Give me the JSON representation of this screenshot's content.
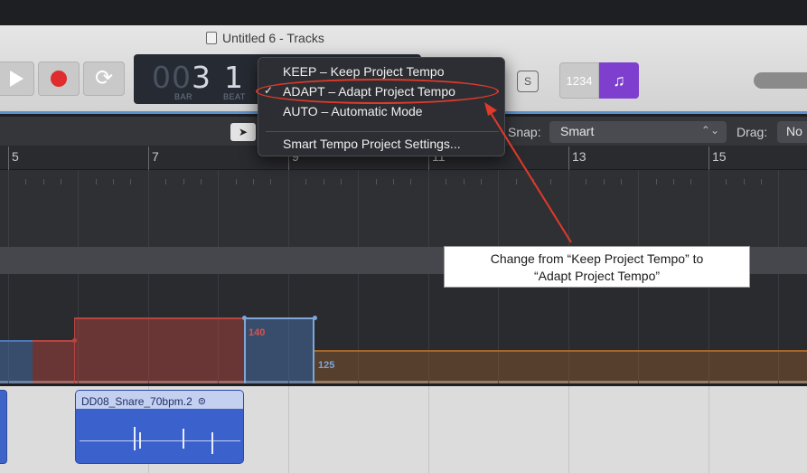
{
  "window": {
    "title": "Untitled 6 - Tracks",
    "doc_icon": "document-icon"
  },
  "transport": {
    "play_icon": "play-icon",
    "record_icon": "record-icon",
    "cycle_icon": "cycle-icon",
    "cycle_glyph": "⟳"
  },
  "lcd": {
    "bar_dim": "00",
    "bar": "3",
    "beat": "1",
    "bar_label": "BAR",
    "beat_label": "BEAT"
  },
  "toolbar_right": {
    "solo_label": "S",
    "count_in_label": "1234",
    "metronome_glyph": "♫"
  },
  "edit_bar": {
    "pointer_glyph": "➤",
    "snap_label": "Snap:",
    "snap_value": "Smart",
    "snap_arrows": "⌃⌄",
    "drag_label": "Drag:",
    "drag_value": "No"
  },
  "ruler": {
    "markers": [
      "5",
      "7",
      "9",
      "11",
      "13",
      "15"
    ]
  },
  "tempo": {
    "value_140": "140",
    "value_125": "125",
    "colors": {
      "red": "#b8443f",
      "blue": "#4a78b8",
      "orange": "#a8652a"
    }
  },
  "region": {
    "name": "DD08_Snare_70bpm.2",
    "loop_glyph": "⊜"
  },
  "smart_tempo_menu": {
    "items": [
      {
        "label": "KEEP – Keep Project Tempo",
        "checked": false
      },
      {
        "label": "ADAPT – Adapt Project Tempo",
        "checked": true
      },
      {
        "label": "AUTO – Automatic Mode",
        "checked": false
      }
    ],
    "check_glyph": "✓",
    "settings_label": "Smart Tempo Project Settings..."
  },
  "annotation": {
    "line1": "Change from “Keep Project Tempo” to",
    "line2": "“Adapt Project Tempo”",
    "color": "#e03a2a"
  }
}
